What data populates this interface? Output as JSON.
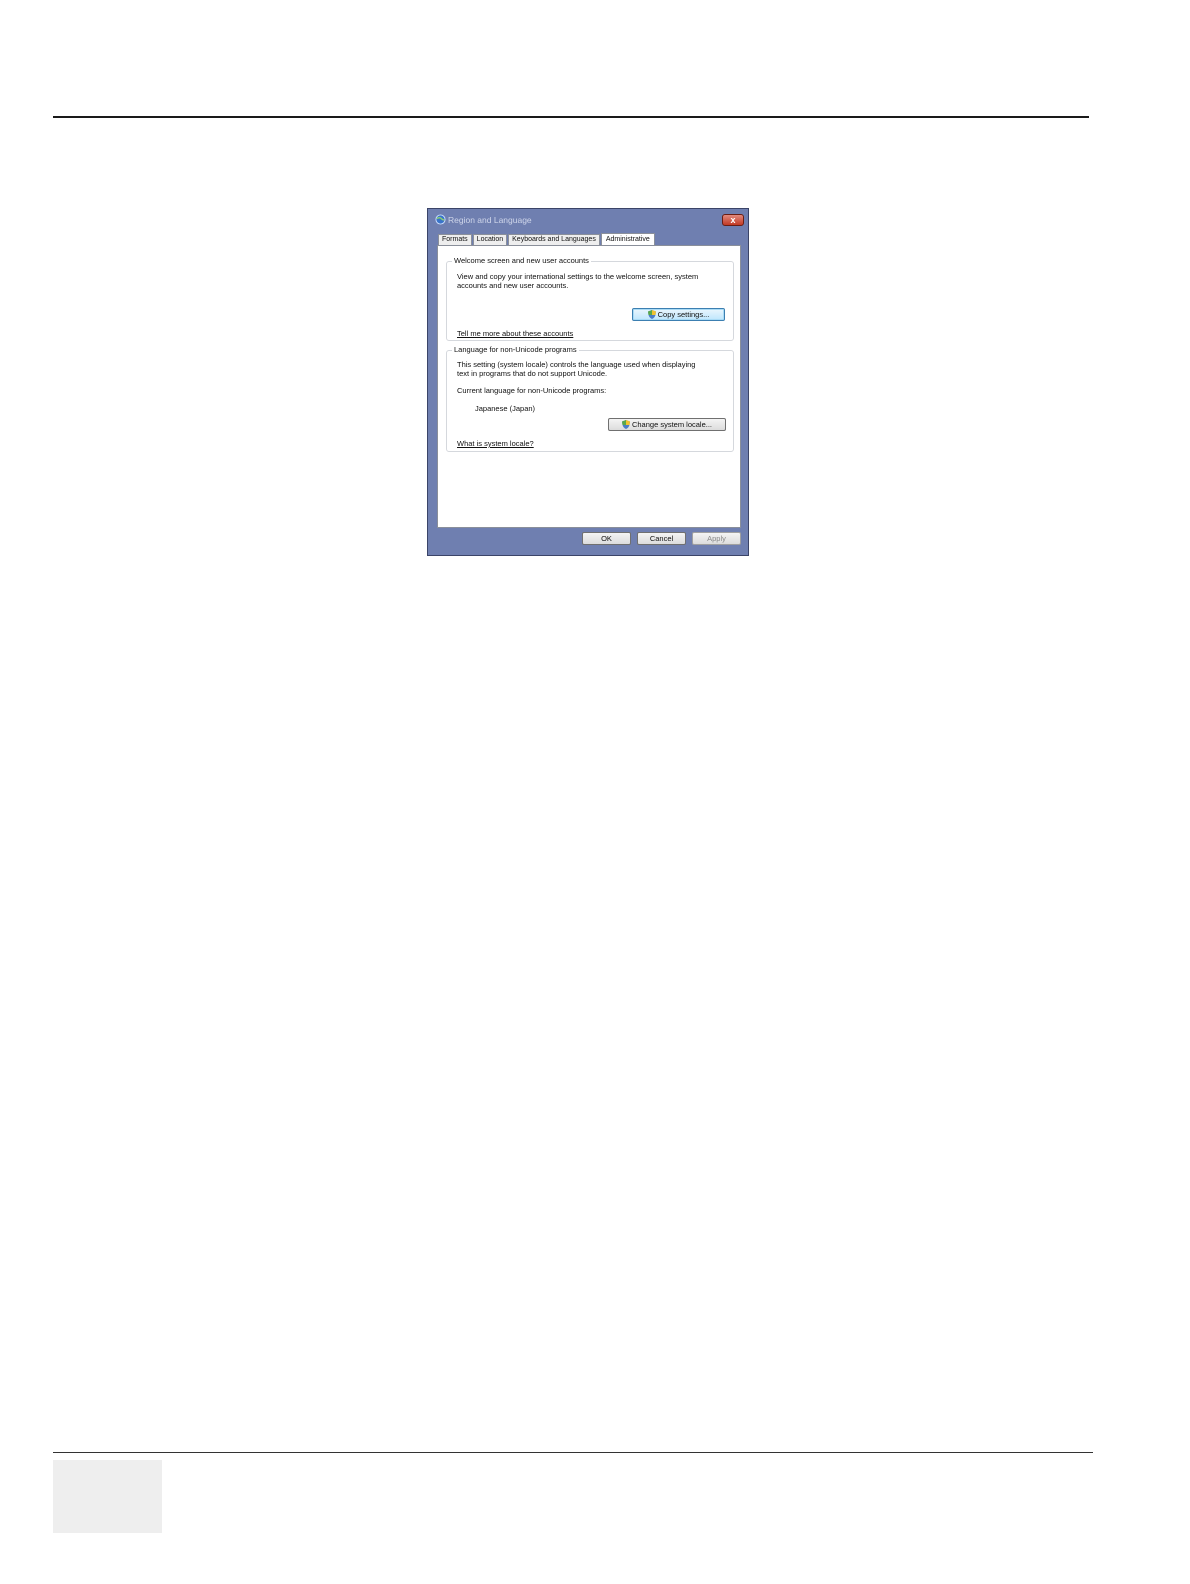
{
  "window": {
    "title": "Region and Language",
    "close_label": "x"
  },
  "tabs": [
    {
      "label": "Formats",
      "active": false
    },
    {
      "label": "Location",
      "active": false
    },
    {
      "label": "Keyboards and Languages",
      "active": false
    },
    {
      "label": "Administrative",
      "active": true
    }
  ],
  "welcome_group": {
    "legend": "Welcome screen and new user accounts",
    "description_line1": "View and copy your international settings to the welcome screen, system",
    "description_line2": "accounts and new user accounts.",
    "copy_button": "Copy settings...",
    "link": "Tell me more about these accounts"
  },
  "locale_group": {
    "legend": "Language for non-Unicode programs",
    "description_line1": "This setting (system locale) controls the language used when displaying",
    "description_line2": "text in programs that do not support Unicode.",
    "current_label": "Current language for non-Unicode programs:",
    "current_value": "Japanese (Japan)",
    "change_button": "Change system locale...",
    "link": "What is system locale?"
  },
  "buttons": {
    "ok": "OK",
    "cancel": "Cancel",
    "apply": "Apply"
  },
  "colors": {
    "dialog_frame": "#6f7fb0",
    "close_button": "#c23a25",
    "focus_button": "#bee6fd"
  }
}
